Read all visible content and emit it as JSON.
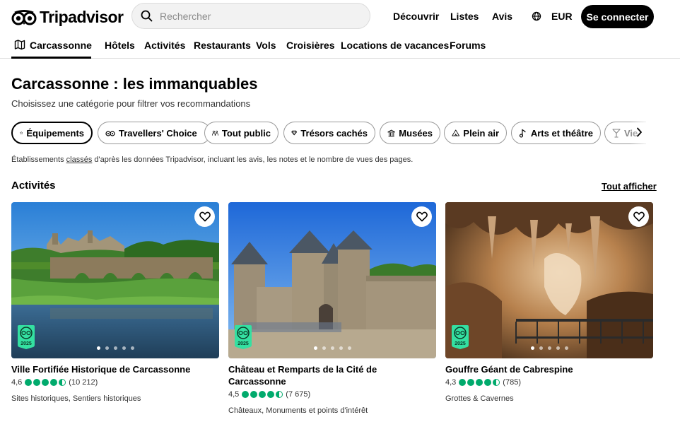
{
  "header": {
    "logo_text": "Tripadvisor",
    "search_placeholder": "Rechercher",
    "nav": [
      "Découvrir",
      "Listes",
      "Avis"
    ],
    "currency": "EUR",
    "signin_label": "Se connecter"
  },
  "subnav": {
    "items": [
      "Carcassonne",
      "Hôtels",
      "Activités",
      "Restaurants",
      "Vols",
      "Croisières",
      "Locations de vacances",
      "Forums"
    ]
  },
  "page": {
    "title": "Carcassonne : les immanquables",
    "subtitle": "Choisissez une catégorie pour filtrer vos recommandations"
  },
  "chips": [
    {
      "label": "Équipements",
      "icon": "star-icon"
    },
    {
      "label": "Travellers' Choice",
      "icon": "owl-icon"
    },
    {
      "label": "Tout public",
      "icon": "family-icon"
    },
    {
      "label": "Trésors cachés",
      "icon": "gem-icon"
    },
    {
      "label": "Musées",
      "icon": "museum-icon"
    },
    {
      "label": "Plein air",
      "icon": "tent-icon"
    },
    {
      "label": "Arts et théâtre",
      "icon": "music-icon"
    },
    {
      "label": "Vie",
      "icon": "cocktail-icon"
    }
  ],
  "ranking_note": {
    "before": "Établissements ",
    "link": "classés",
    "after": " d'après les données Tripadvisor, incluant les avis, les notes et le nombre de vues des pages."
  },
  "section": {
    "title": "Activités",
    "see_all": "Tout afficher"
  },
  "cards": [
    {
      "title": "Ville Fortifiée Historique de Carcassonne",
      "rating": "4,6",
      "rating_value": 4.5,
      "reviews": "(10 212)",
      "category": "Sites historiques, Sentiers historiques",
      "badge_year": "2025"
    },
    {
      "title": "Château et Remparts de la Cité de Carcassonne",
      "rating": "4,5",
      "rating_value": 4.5,
      "reviews": "(7 675)",
      "category": "Châteaux, Monuments et points d'intérêt",
      "badge_year": "2025"
    },
    {
      "title": "Gouffre Géant de Cabrespine",
      "rating": "4,3",
      "rating_value": 4.5,
      "reviews": "(785)",
      "category": "Grottes & Cavernes",
      "badge_year": "2025"
    }
  ],
  "colors": {
    "brand_green": "#00aa6c",
    "badge_green": "#34e0a1",
    "signin_bg": "#000000"
  }
}
